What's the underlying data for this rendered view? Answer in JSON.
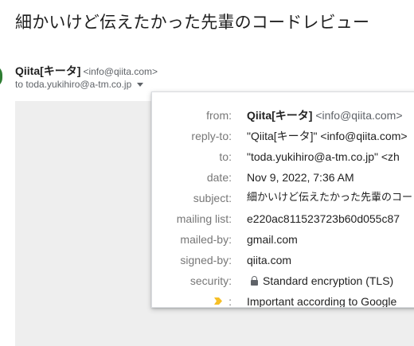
{
  "email": {
    "subject": "細かいけど伝えたかった先輩のコードレビュー",
    "sender_name": "Qiita[キータ]",
    "sender_email": "<info@qiita.com>",
    "recipient": "to toda.yukihiro@a-tm.co.jp"
  },
  "details": {
    "from_label": "from:",
    "from_name": "Qiita[キータ]",
    "from_email": "<info@qiita.com>",
    "reply_to_label": "reply-to:",
    "reply_to_value": "\"Qiita[キータ]\" <info@qiita.com>",
    "to_label": "to:",
    "to_value": "\"toda.yukihiro@a-tm.co.jp\" <zh",
    "date_label": "date:",
    "date_value": "Nov 9, 2022, 7:36 AM",
    "subject_label": "subject:",
    "subject_value": "細かいけど伝えたかった先輩のコードレビュー",
    "mailing_list_label": "mailing list:",
    "mailing_list_value": "e220ac811523723b60d055c87",
    "mailed_by_label": "mailed-by:",
    "mailed_by_value": "gmail.com",
    "signed_by_label": "signed-by:",
    "signed_by_value": "qiita.com",
    "security_label": "security:",
    "security_value": "Standard encryption (TLS)",
    "importance_label": ":",
    "importance_value": "Important according to Google"
  },
  "icons": {
    "lock": "lock-icon",
    "importance": "importance-marker-icon",
    "dropdown": "chevron-down-icon"
  },
  "colors": {
    "importance_marker": "#f6bf26",
    "label_text": "#777777",
    "value_text": "#222222"
  }
}
